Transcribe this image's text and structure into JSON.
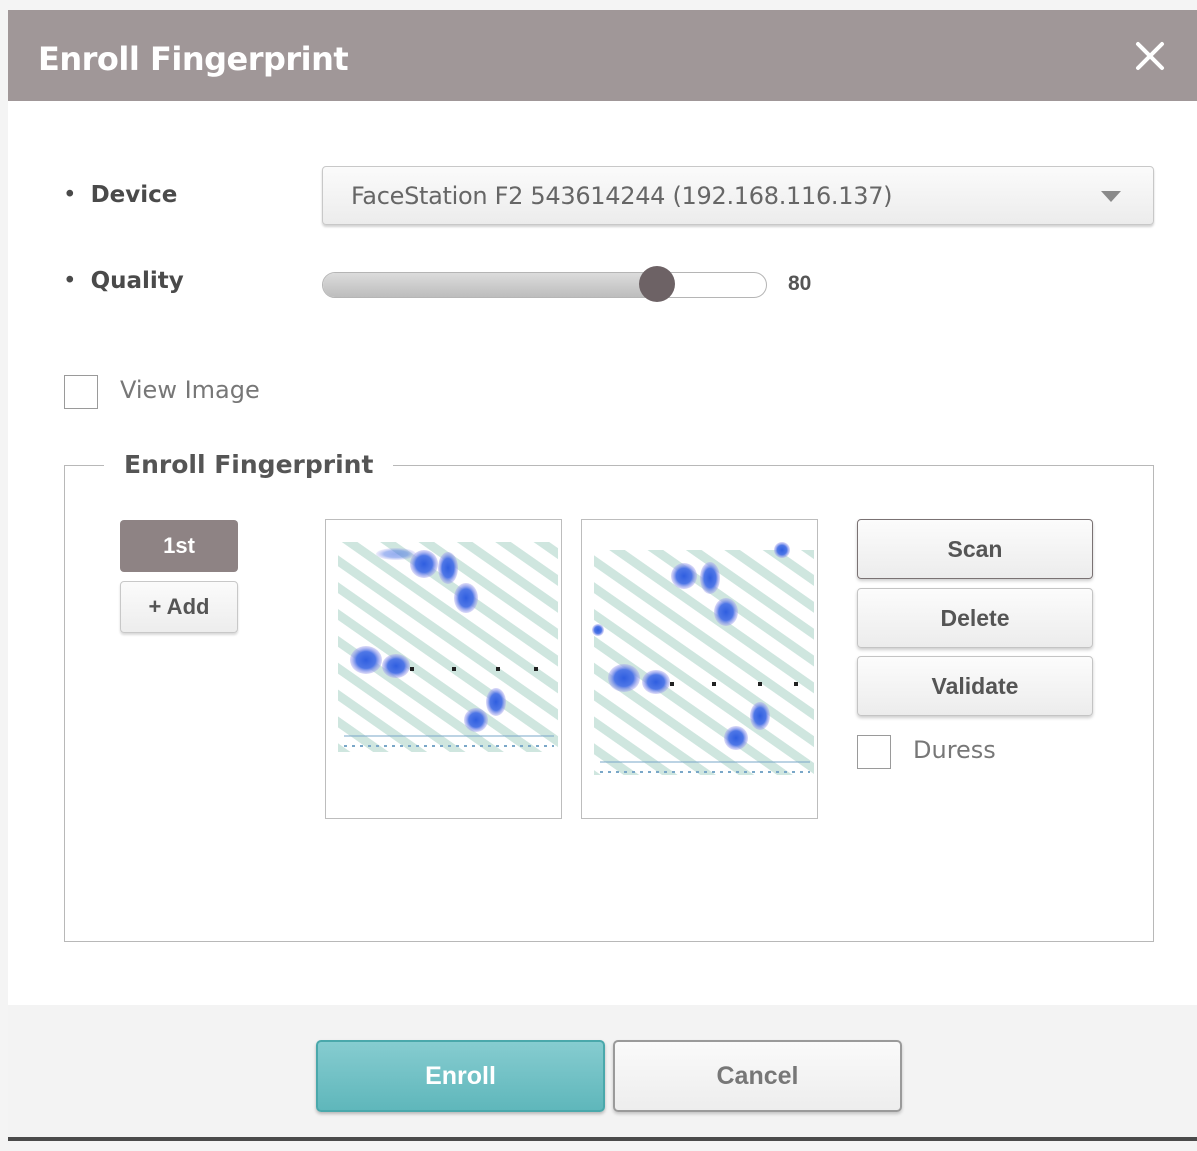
{
  "dialog": {
    "title": "Enroll Fingerprint",
    "close_icon": "close-icon"
  },
  "form": {
    "device_label": "Device",
    "device_value": "FaceStation F2 543614244 (192.168.116.137)",
    "quality_label": "Quality",
    "quality_value": "80",
    "quality_level": 0.8,
    "view_image_label": "View Image",
    "view_image_checked": false
  },
  "enroll_section": {
    "legend": "Enroll Fingerprint",
    "tabs": [
      {
        "label": "1st",
        "selected": true
      }
    ],
    "add_label": "+ Add",
    "images": [
      "fingerprint-template-1",
      "fingerprint-template-2"
    ],
    "buttons": {
      "scan": "Scan",
      "delete": "Delete",
      "validate": "Validate"
    },
    "duress_label": "Duress",
    "duress_checked": false
  },
  "footer": {
    "enroll_label": "Enroll",
    "cancel_label": "Cancel"
  },
  "colors": {
    "title_bar": "#a09798",
    "tab_selected": "#8e8384",
    "slider_thumb": "#6d6265",
    "enroll_button": "#5fb7bb",
    "fingerprint_blue": "#3f6fe0"
  }
}
